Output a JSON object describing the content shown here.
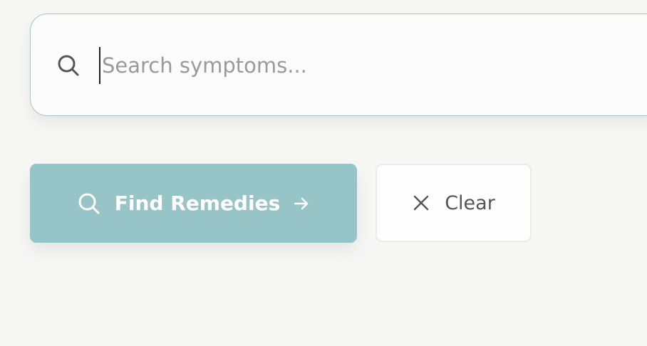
{
  "search": {
    "placeholder": "Search symptoms...",
    "value": "",
    "icon": "search-icon"
  },
  "actions": {
    "find_label": "Find Remedies",
    "find_leading_icon": "search-icon",
    "find_trailing_icon": "arrow-right-icon",
    "clear_label": "Clear",
    "clear_icon": "close-icon"
  },
  "colors": {
    "accent": "#97c4c6",
    "input_border": "#9cc9c5",
    "background": "#f7f7f6"
  }
}
